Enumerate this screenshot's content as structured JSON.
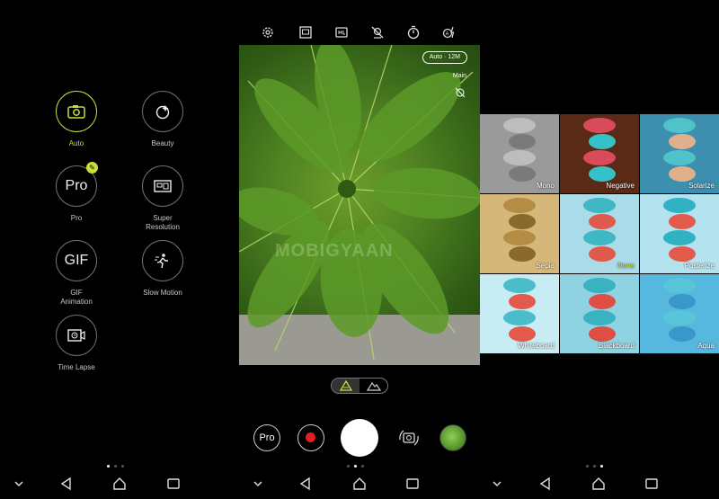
{
  "modes": [
    {
      "label": "Auto",
      "icon": "camera-icon",
      "glyph": "",
      "active": true
    },
    {
      "label": "Beauty",
      "icon": "beauty-icon",
      "glyph": "",
      "active": false
    },
    {
      "label": "Pro",
      "icon": "pro-icon",
      "glyph": "Pro",
      "active": false
    },
    {
      "label": "Super Resolution",
      "icon": "super-resolution-icon",
      "glyph": "",
      "active": false
    },
    {
      "label": "GIF Animation",
      "icon": "gif-icon",
      "glyph": "GIF",
      "active": false
    },
    {
      "label": "Slow Motion",
      "icon": "slow-motion-icon",
      "glyph": "",
      "active": false
    },
    {
      "label": "Time Lapse",
      "icon": "time-lapse-icon",
      "glyph": "",
      "active": false
    }
  ],
  "viewfinder": {
    "resolution_pill": "Auto · 12M",
    "camera_label": "Main",
    "watermark": "MOBIGYAAN"
  },
  "controls": {
    "pro_label": "Pro"
  },
  "filters": [
    {
      "name": "Mono",
      "bg": "#9a9a9a",
      "c1": "#7a7a7a",
      "c2": "#bdbdbd"
    },
    {
      "name": "Negative",
      "bg": "#5b2a16",
      "c1": "#36c1c9",
      "c2": "#d94a5b"
    },
    {
      "name": "Solarize",
      "bg": "#3d8fb0",
      "c1": "#e0b08c",
      "c2": "#4fc3c9"
    },
    {
      "name": "Sepia",
      "bg": "#d6b77a",
      "c1": "#8a6a2c",
      "c2": "#b58c44"
    },
    {
      "name": "None",
      "bg": "#a9dbe8",
      "c1": "#e05a4b",
      "c2": "#3fb7c4"
    },
    {
      "name": "Posterize",
      "bg": "#b4e2ef",
      "c1": "#e25a4b",
      "c2": "#2fb3c3"
    },
    {
      "name": "Whiteboard",
      "bg": "#c7ecf4",
      "c1": "#e25a4b",
      "c2": "#49bdca"
    },
    {
      "name": "Blackboard",
      "bg": "#8fd3e3",
      "c1": "#dd4e44",
      "c2": "#39b2c1"
    },
    {
      "name": "Aqua",
      "bg": "#56b8de",
      "c1": "#3a98c9",
      "c2": "#58c6d9"
    }
  ],
  "colors": {
    "accent": "#c9dd3a",
    "record": "#e02020"
  }
}
